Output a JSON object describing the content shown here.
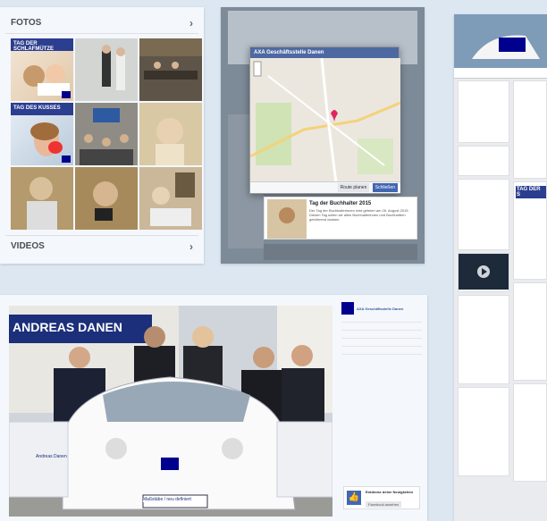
{
  "panel1": {
    "section_title": "FOTOS",
    "tags": [
      "TAG DER SCHLAFMÜTZE",
      "TAG DES KUSSES"
    ],
    "videos_label": "VIDEOS"
  },
  "panel2": {
    "dialog_title": "AXA Geschäftsstelle Danen",
    "post_title": "Tag der Buchhalter 2015",
    "post_text": "Der Tag der Buchhalterinnen wird gefeiert am 26. August 2015. Diesen Tag sollen wir allen Buchhalterinnen und Buchhaltern gebührend danken.",
    "buttons": [
      "Route planen",
      "Schließen"
    ]
  },
  "panel3": {
    "sign_text": "ANDREAS DANEN",
    "car_text": "Maßstäbe / neu definiert",
    "door_name": "Andreas Danen",
    "page_name": "AXA Geschäftsstelle Danen",
    "promo_title": "Entdecke deine Neuigkeiten",
    "promo_button": "Facebook ansehen"
  },
  "panel4": {
    "tag_label": "TAG DER S"
  },
  "colors": {
    "axa_blue": "#00008f",
    "axa_red": "#ff1721",
    "fb_blue": "#4267b2"
  }
}
